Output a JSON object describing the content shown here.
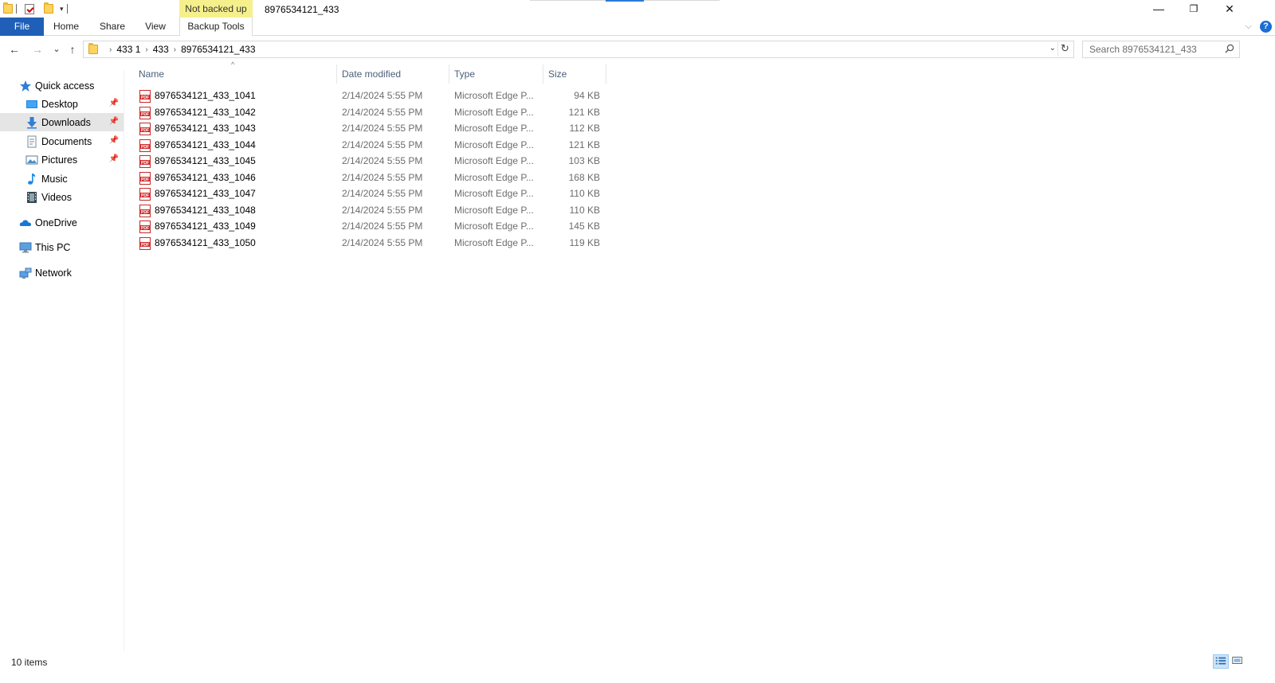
{
  "window": {
    "title": "8976534121_433",
    "context_tab_group": "Not backed up",
    "minimize_glyph": "—",
    "restore_glyph": "❐",
    "close_glyph": "✕"
  },
  "quick_access_toolbar": {
    "dropdown_glyph": "▾"
  },
  "ribbon": {
    "tabs": [
      {
        "label": "File"
      },
      {
        "label": "Home"
      },
      {
        "label": "Share"
      },
      {
        "label": "View"
      },
      {
        "label": "Backup Tools"
      }
    ],
    "expand_glyph": "⌵",
    "help_glyph": "?"
  },
  "address_bar": {
    "breadcrumbs": [
      "433 1",
      "433",
      "8976534121_433"
    ],
    "separator": "›",
    "back_glyph": "←",
    "forward_glyph": "→",
    "recent_glyph": "⌄",
    "up_glyph": "↑",
    "dropdown_glyph": "⌄",
    "refresh_glyph": "↻"
  },
  "search": {
    "placeholder": "Search 8976534121_433"
  },
  "nav_pane": {
    "items": [
      {
        "label": "Quick access",
        "icon": "star-icon",
        "pinned": false
      },
      {
        "label": "Desktop",
        "icon": "desktop-icon",
        "pinned": true
      },
      {
        "label": "Downloads",
        "icon": "download-icon",
        "pinned": true,
        "selected": true
      },
      {
        "label": "Documents",
        "icon": "documents-icon",
        "pinned": true
      },
      {
        "label": "Pictures",
        "icon": "pictures-icon",
        "pinned": true
      },
      {
        "label": "Music",
        "icon": "music-icon",
        "pinned": false
      },
      {
        "label": "Videos",
        "icon": "videos-icon",
        "pinned": false
      },
      {
        "label": "OneDrive",
        "icon": "onedrive-icon",
        "pinned": false
      },
      {
        "label": "This PC",
        "icon": "pc-icon",
        "pinned": false
      },
      {
        "label": "Network",
        "icon": "network-icon",
        "pinned": false
      }
    ],
    "pin_glyph": "📌"
  },
  "file_list": {
    "sort_glyph": "^",
    "columns": {
      "name": "Name",
      "date": "Date modified",
      "type": "Type",
      "size": "Size"
    },
    "files": [
      {
        "name": "8976534121_433_1041",
        "date": "2/14/2024 5:55 PM",
        "type": "Microsoft Edge P...",
        "size": "94 KB"
      },
      {
        "name": "8976534121_433_1042",
        "date": "2/14/2024 5:55 PM",
        "type": "Microsoft Edge P...",
        "size": "121 KB"
      },
      {
        "name": "8976534121_433_1043",
        "date": "2/14/2024 5:55 PM",
        "type": "Microsoft Edge P...",
        "size": "112 KB"
      },
      {
        "name": "8976534121_433_1044",
        "date": "2/14/2024 5:55 PM",
        "type": "Microsoft Edge P...",
        "size": "121 KB"
      },
      {
        "name": "8976534121_433_1045",
        "date": "2/14/2024 5:55 PM",
        "type": "Microsoft Edge P...",
        "size": "103 KB"
      },
      {
        "name": "8976534121_433_1046",
        "date": "2/14/2024 5:55 PM",
        "type": "Microsoft Edge P...",
        "size": "168 KB"
      },
      {
        "name": "8976534121_433_1047",
        "date": "2/14/2024 5:55 PM",
        "type": "Microsoft Edge P...",
        "size": "110 KB"
      },
      {
        "name": "8976534121_433_1048",
        "date": "2/14/2024 5:55 PM",
        "type": "Microsoft Edge P...",
        "size": "110 KB"
      },
      {
        "name": "8976534121_433_1049",
        "date": "2/14/2024 5:55 PM",
        "type": "Microsoft Edge P...",
        "size": "145 KB"
      },
      {
        "name": "8976534121_433_1050",
        "date": "2/14/2024 5:55 PM",
        "type": "Microsoft Edge P...",
        "size": "119 KB"
      }
    ]
  },
  "status_bar": {
    "item_count": "10 items"
  },
  "colors": {
    "file_tab": "#1f5fb8",
    "context_tab": "#f6f08c",
    "selected_nav": "#e5e5e5",
    "column_header_text": "#4c607a",
    "pdf_red": "#d32f2f"
  }
}
